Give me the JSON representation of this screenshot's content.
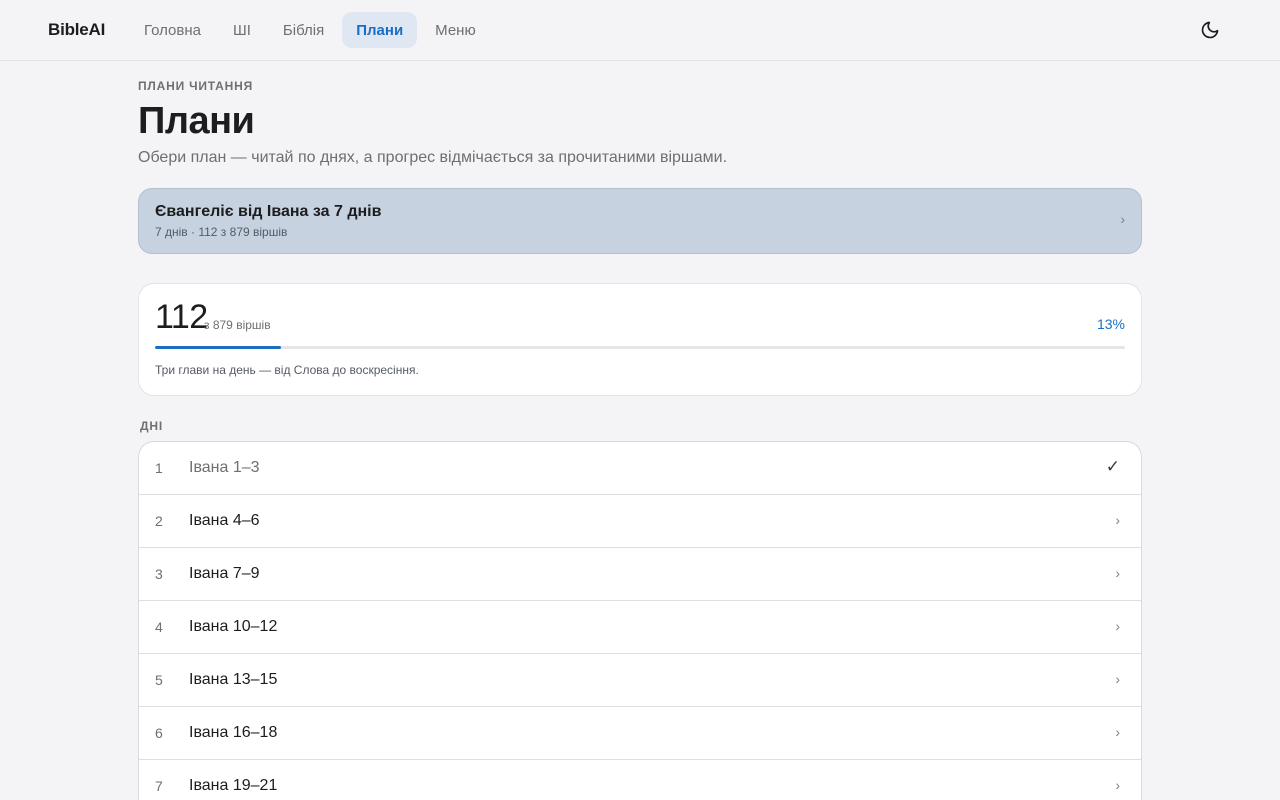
{
  "app": {
    "brand": "BibleAI"
  },
  "nav": {
    "items": [
      {
        "label": "Головна",
        "active": false
      },
      {
        "label": "ШІ",
        "active": false
      },
      {
        "label": "Біблія",
        "active": false
      },
      {
        "label": "Плани",
        "active": true
      },
      {
        "label": "Меню",
        "active": false
      }
    ],
    "theme_icon": "moon-icon"
  },
  "header": {
    "eyebrow": "ПЛАНИ ЧИТАННЯ",
    "title": "Плани",
    "subtitle": "Обери план — читай по днях, а прогрес відмічається за прочитаними віршами."
  },
  "plan": {
    "name": "Євангеліє від Івана за 7 днів",
    "meta": "7 днів · 112 з 879 віршів",
    "chevron": "›"
  },
  "progress": {
    "count": "112",
    "total_label": "з 879 віршів",
    "percent_label": "13%",
    "fraction": 0.13,
    "description": "Три глави на день — від Слова до воскресіння."
  },
  "days": {
    "label": "ДНІ",
    "items": [
      {
        "num": "1",
        "ref": "Івана 1–3",
        "mark": "✓",
        "done": true
      },
      {
        "num": "2",
        "ref": "Івана 4–6",
        "mark": "›",
        "done": false
      },
      {
        "num": "3",
        "ref": "Івана 7–9",
        "mark": "›",
        "done": false
      },
      {
        "num": "4",
        "ref": "Івана 10–12",
        "mark": "›",
        "done": false
      },
      {
        "num": "5",
        "ref": "Івана 13–15",
        "mark": "›",
        "done": false
      },
      {
        "num": "6",
        "ref": "Івана 16–18",
        "mark": "›",
        "done": false
      },
      {
        "num": "7",
        "ref": "Івана 19–21",
        "mark": "›",
        "done": false
      }
    ]
  },
  "colors": {
    "accent": "#1a6fc4",
    "nav_active_bg": "#dfe7f2",
    "plan_card_bg": "#c7d2e0",
    "page_bg": "#f4f4f6"
  }
}
